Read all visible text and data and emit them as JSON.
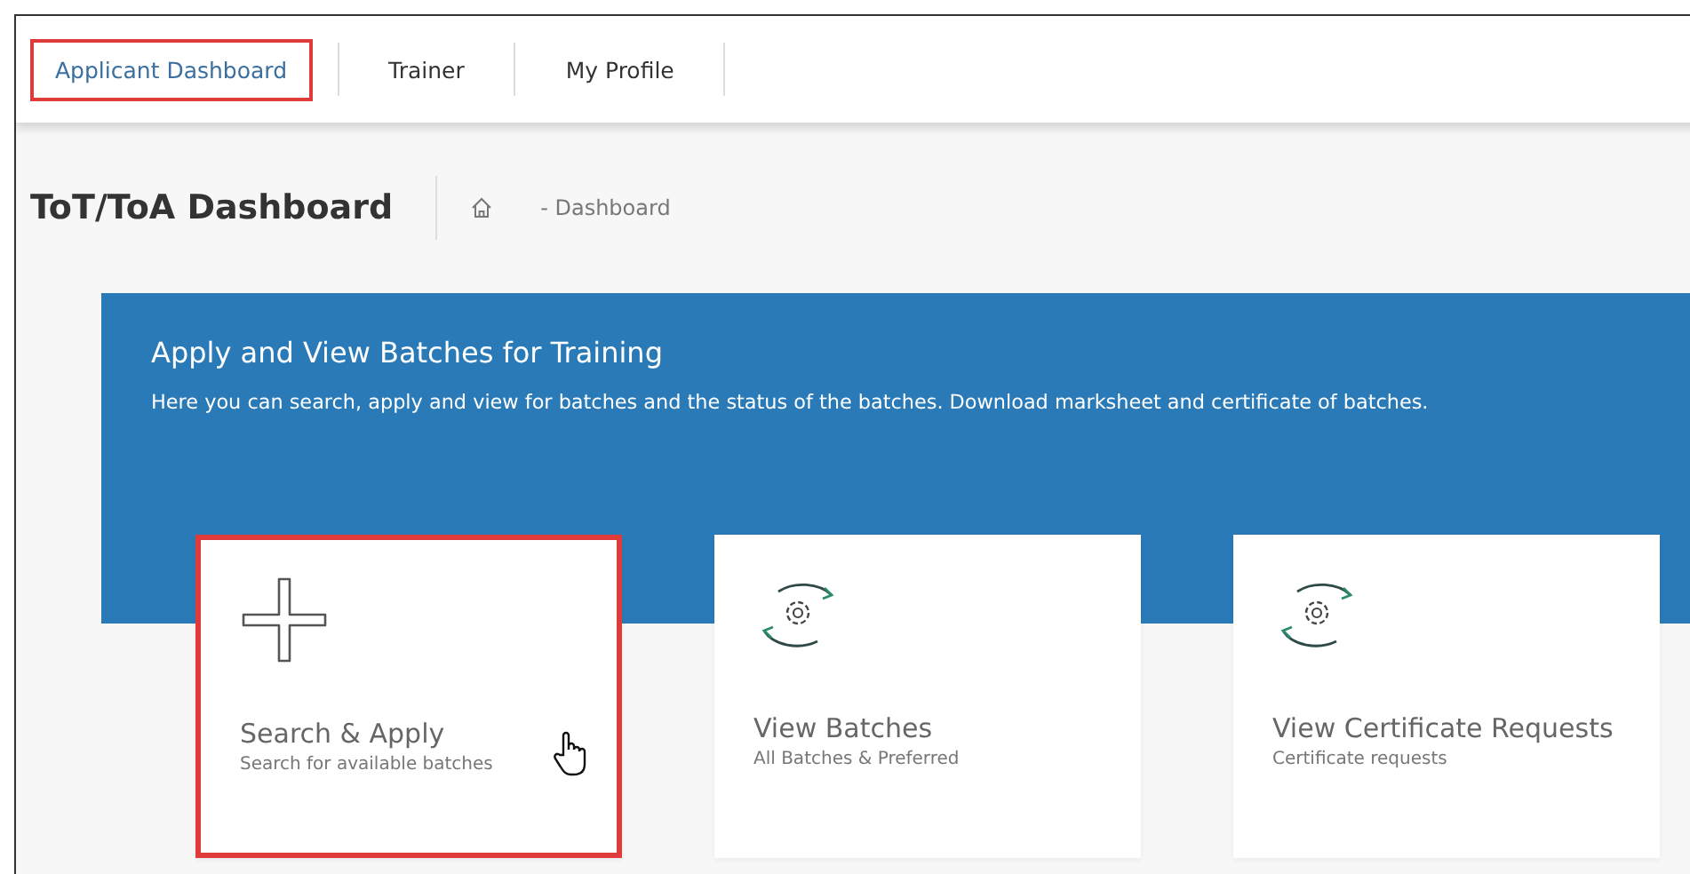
{
  "nav": [
    {
      "label": "Applicant Dashboard",
      "selected": true
    },
    {
      "label": "Trainer",
      "selected": false
    },
    {
      "label": "My Profile",
      "selected": false
    }
  ],
  "page_title": "ToT/ToA Dashboard",
  "breadcrumb": {
    "current": "- Dashboard"
  },
  "banner": {
    "title": "Apply and View Batches for Training",
    "description": "Here you can search, apply and view for batches and the status of the batches. Download marksheet and certificate of batches."
  },
  "cards": [
    {
      "kind": "plus",
      "title": "Search & Apply",
      "subtitle": "Search for available batches",
      "highlighted": true,
      "pointer": true
    },
    {
      "kind": "cycle",
      "title": "View Batches",
      "subtitle": "All Batches & Preferred",
      "highlighted": false,
      "pointer": false
    },
    {
      "kind": "cycle",
      "title": "View Certificate Requests",
      "subtitle": "Certificate requests",
      "highlighted": false,
      "pointer": false
    }
  ]
}
